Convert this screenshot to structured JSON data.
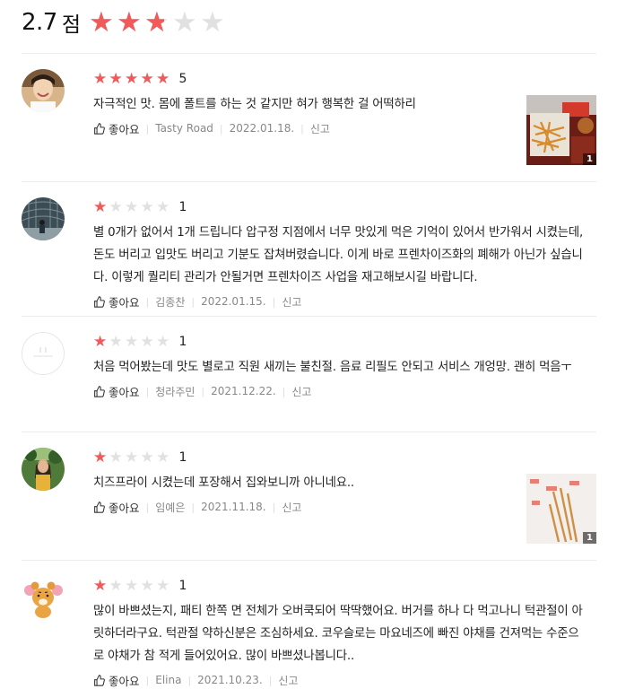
{
  "summary": {
    "score": "2.7",
    "unit": "점",
    "rating": 2.7
  },
  "reviews": [
    {
      "rating": 5,
      "rating_label": "5",
      "text": "자극적인 맛. 몸에 폴트를 하는 것 같지만 혀가 행복한 걸 어떡하리",
      "like_label": "좋아요",
      "author": "Tasty Road",
      "date": "2022.01.18.",
      "report_label": "신고",
      "photo_count": "1",
      "avatar": "woman-smiling-photo",
      "thumb": "fries-tray-photo"
    },
    {
      "rating": 1,
      "rating_label": "1",
      "text": "별 0개가 없어서 1개 드립니다  압구정 지점에서 너무 맛있게 먹은 기억이 있어서 반가워서 시켰는데, 돈도 버리고 입맛도 버리고 기분도 잡쳐버렸습니다.  이게 바로 프렌차이즈화의 폐해가 아닌가 싶습니다.  이렇게 퀄리티 관리가 안될거면 프렌차이즈 사업을 재고해보시길 바랍니다.",
      "like_label": "좋아요",
      "author": "김종찬",
      "date": "2022.01.15.",
      "report_label": "신고",
      "avatar": "person-in-tunnel-photo"
    },
    {
      "rating": 1,
      "rating_label": "1",
      "text": "처음 먹어봤는데 맛도 별로고 직원 새끼는 불친절. 음료 리필도 안되고 서비스 개엉망. 괜히 먹음ㅜ",
      "like_label": "좋아요",
      "author": "청라주민",
      "date": "2021.12.22.",
      "report_label": "신고",
      "avatar": "default-avatar"
    },
    {
      "rating": 1,
      "rating_label": "1",
      "text": "치즈프라이 시켰는데 포장해서 집와보니까 아니네요..",
      "like_label": "좋아요",
      "author": "임예은",
      "date": "2021.11.18.",
      "report_label": "신고",
      "photo_count": "1",
      "avatar": "woman-outdoor-photo",
      "thumb": "fries-packaged-photo"
    },
    {
      "rating": 1,
      "rating_label": "1",
      "text": "많이 바쁘셨는지, 패티 한쪽 면 전체가 오버쿡되어 딱딱했어요. 버거를 하나 다 먹고나니 턱관절이 아릿하더라구요. 턱관절 약하신분은 조심하세요. 코우슬로는 마요네즈에 빠진 야채를 건져먹는 수준으로 야채가 참 적게 들어있어요. 많이 바쁘셨나봅니다..",
      "like_label": "좋아요",
      "author": "Elina",
      "date": "2021.10.23.",
      "report_label": "신고",
      "avatar": "bear-character-avatar"
    }
  ],
  "colors": {
    "star_active": "#f05a5a",
    "star_inactive": "#e1e1e1",
    "meta_text": "#888888"
  }
}
